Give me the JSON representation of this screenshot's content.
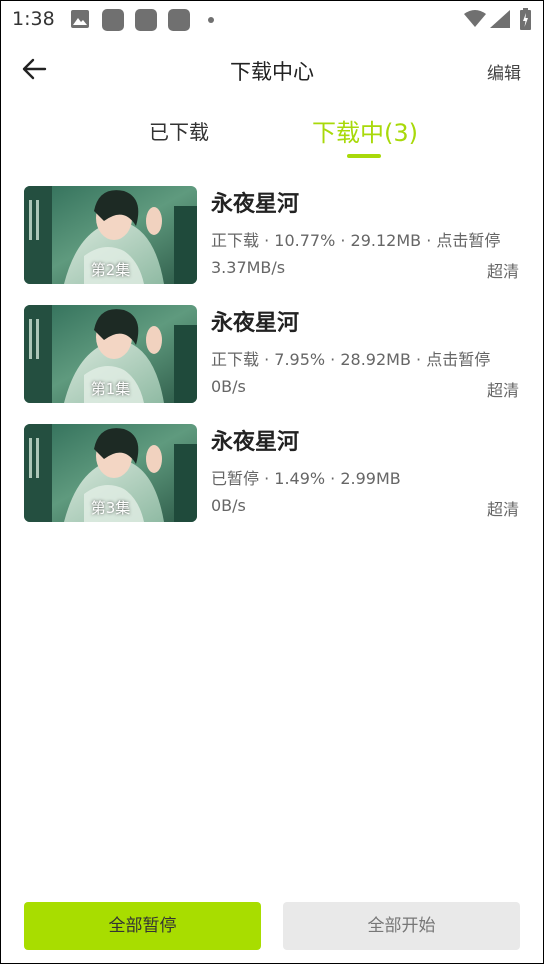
{
  "status_bar": {
    "time": "1:38",
    "icons": [
      "image-icon",
      "app-icon",
      "app-icon",
      "app-icon",
      "dot-icon",
      "wifi-icon",
      "signal-icon",
      "battery-icon"
    ]
  },
  "header": {
    "back_icon": "arrow-left-icon",
    "title": "下载中心",
    "edit_label": "编辑"
  },
  "tabs": [
    {
      "label": "已下载",
      "active": false
    },
    {
      "label": "下载中(3)",
      "active": true
    }
  ],
  "accent_color": "#a8d90a",
  "downloads": [
    {
      "title": "永夜星河",
      "episode": "第2集",
      "info": "正下载 · 10.77% · 29.12MB · 点击暂停",
      "speed": "3.37MB/s",
      "quality": "超清"
    },
    {
      "title": "永夜星河",
      "episode": "第1集",
      "info": "正下载 · 7.95% · 28.92MB · 点击暂停",
      "speed": "0B/s",
      "quality": "超清"
    },
    {
      "title": "永夜星河",
      "episode": "第3集",
      "info": "已暂停 · 1.49% · 2.99MB",
      "speed": "0B/s",
      "quality": "超清"
    }
  ],
  "footer": {
    "pause_all_label": "全部暂停",
    "start_all_label": "全部开始"
  }
}
